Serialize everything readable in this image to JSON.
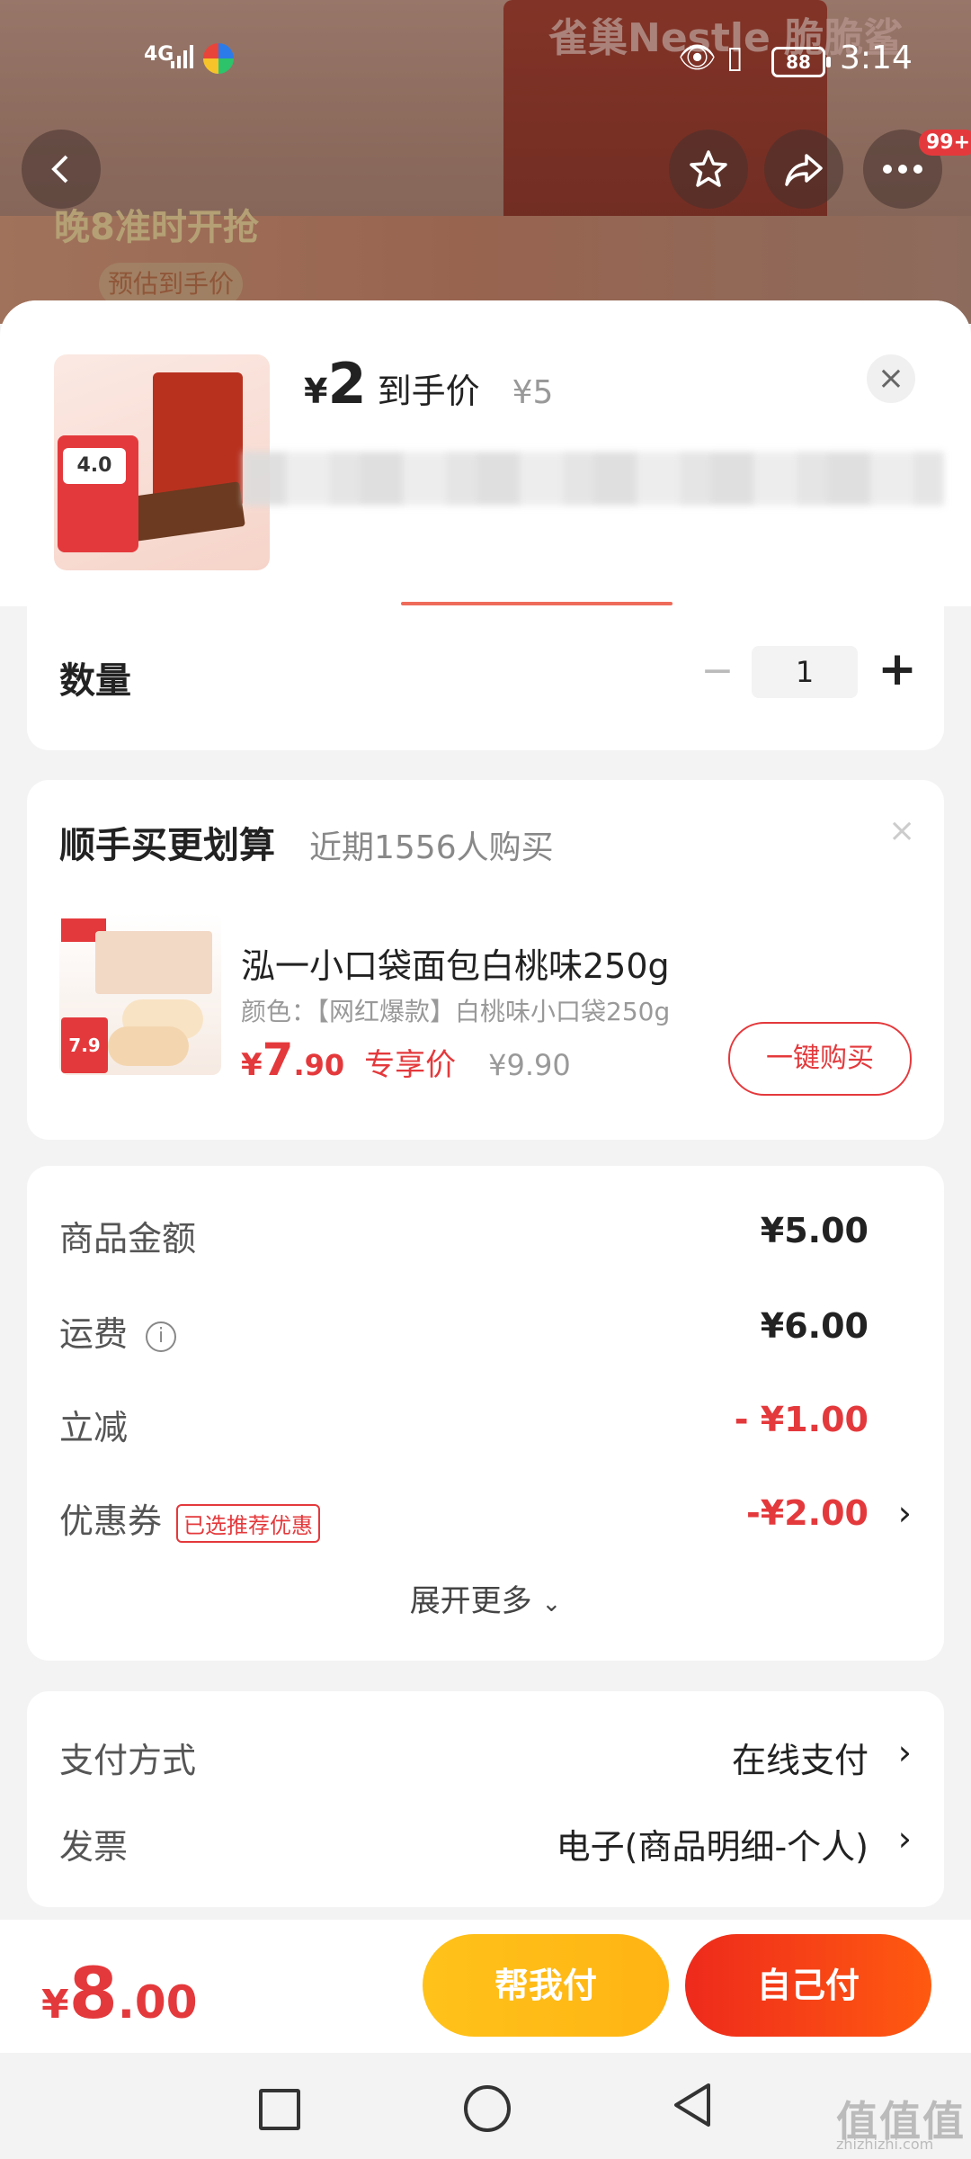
{
  "status_bar": {
    "network": "4G",
    "battery": "88",
    "time": "3:14"
  },
  "background": {
    "brand": "雀巢Nestle 脆脆鲨",
    "promo": "晚8准时开抢",
    "presale": "预估到手价",
    "more_badge": "99+"
  },
  "sheet": {
    "currency": "¥",
    "price": "2",
    "price_label": "到手价",
    "original_price": "¥5",
    "thumb_rating": "4.0",
    "close": "×"
  },
  "quantity": {
    "label": "数量",
    "minus": "−",
    "value": "1",
    "plus": "+"
  },
  "addon": {
    "title": "顺手买更划算",
    "subtitle": "近期1556人购买",
    "close": "×",
    "product_name": "泓一小口袋面包白桃味250g",
    "spec": "颜色：【网红爆款】白桃味小口袋250g",
    "price_yen": "¥",
    "price_int": "7",
    "price_dec": ".90",
    "price_tag": "专享价",
    "original_price": "¥9.90",
    "thumb_price": "7.9",
    "buy_label": "一键购买"
  },
  "costs": {
    "goods_label": "商品金额",
    "goods_value": "¥5.00",
    "shipping_label": "运费",
    "shipping_value": "¥6.00",
    "discount_label": "立减",
    "discount_value": "- ¥1.00",
    "coupon_label": "优惠券",
    "coupon_tag": "已选推荐优惠",
    "coupon_value": "-¥2.00",
    "expand_label": "展开更多"
  },
  "payment": {
    "method_label": "支付方式",
    "method_value": "在线支付",
    "invoice_label": "发票",
    "invoice_value": "电子(商品明细-个人)"
  },
  "bottom": {
    "total_yen": "¥",
    "total_int": "8",
    "total_dec": ".00",
    "help_pay": "帮我付",
    "self_pay": "自己付"
  },
  "watermark": {
    "main": "值值值",
    "sub": "zhizhizhi.com"
  },
  "colors": {
    "accent": "#e4393c",
    "help_pay": "#ffb414",
    "self_pay": "#ee2a1c"
  }
}
